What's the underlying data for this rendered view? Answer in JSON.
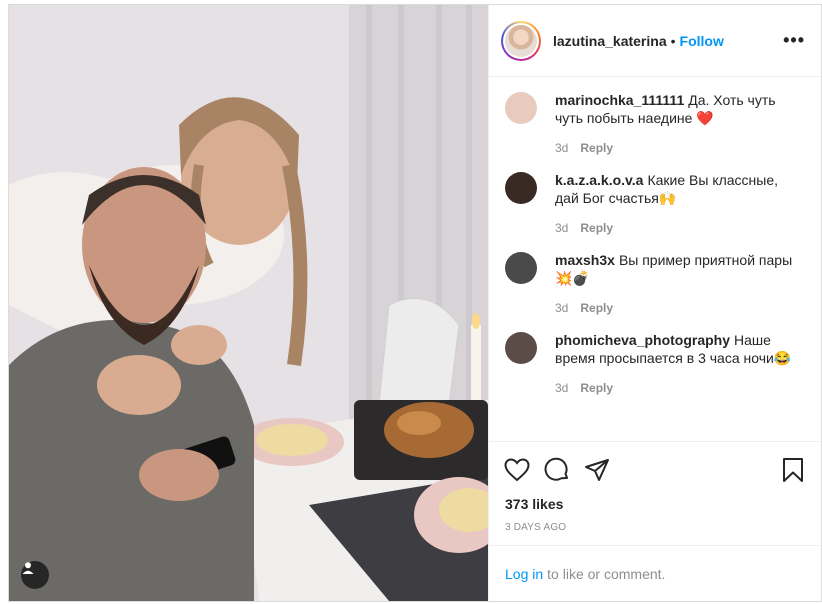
{
  "header": {
    "username": "lazutina_katerina",
    "separator": "•",
    "follow_label": "Follow",
    "more_label": "•••"
  },
  "comments": [
    {
      "username": "marinochka_111111",
      "text": "Да. Хоть чуть чуть побыть наедине ❤️",
      "time": "3d",
      "reply_label": "Reply",
      "avatar_color": "#e8cbbd"
    },
    {
      "username": "k.a.z.a.k.o.v.a",
      "text": "Какие Вы классные, дай Бог счастья🙌",
      "time": "3d",
      "reply_label": "Reply",
      "avatar_color": "#3a2a24"
    },
    {
      "username": "maxsh3x",
      "text": "Вы пример приятной пары 💥💣",
      "time": "3d",
      "reply_label": "Reply",
      "avatar_color": "#4a4a4a"
    },
    {
      "username": "phomicheva_photography",
      "text": "Наше время просыпается в 3 часа ночи😂",
      "time": "3d",
      "reply_label": "Reply",
      "avatar_color": "#5b4c48"
    }
  ],
  "actions": {
    "icons": [
      "heart-icon",
      "comment-icon",
      "share-icon",
      "bookmark-icon"
    ],
    "likes": "373 likes",
    "posted_ago": "3 DAYS AGO"
  },
  "login_bar": {
    "login_label": "Log in",
    "suffix": "to like or comment."
  },
  "colors": {
    "accent": "#0095f6",
    "text": "#262626",
    "muted": "#8e8e8e",
    "border": "#dbdbdb"
  }
}
